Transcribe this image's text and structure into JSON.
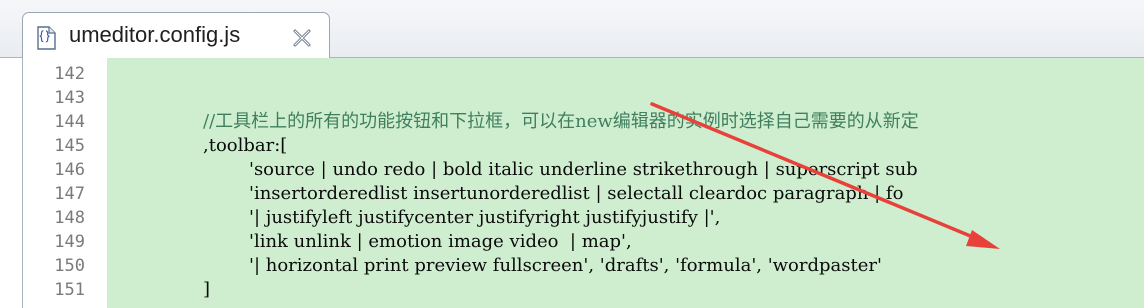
{
  "tab": {
    "title": "umeditor.config.js",
    "file_icon": "js-file-icon",
    "close_icon": "close-icon"
  },
  "editor": {
    "highlight_color": "#cfeecf",
    "line_numbers": [
      "142",
      "143",
      "144",
      "145",
      "146",
      "147",
      "148",
      "149",
      "150",
      "151"
    ],
    "lines": [
      "",
      "",
      "//工具栏上的所有的功能按钮和下拉框，可以在new编辑器的实例时选择自己需要的从新定",
      ",toolbar:[",
      "'source | undo redo | bold italic underline strikethrough | superscript sub",
      "'insertorderedlist insertunorderedlist | selectall cleardoc paragraph | fo",
      "'| justifyleft justifycenter justifyright justifyjustify |',",
      "'link unlink | emotion image video  | map',",
      "'| horizontal print preview fullscreen', 'drafts', 'formula', 'wordpaster'",
      "]"
    ]
  },
  "annotation": {
    "arrow_color": "#e8413a",
    "arrow_target": "wordpaster"
  }
}
